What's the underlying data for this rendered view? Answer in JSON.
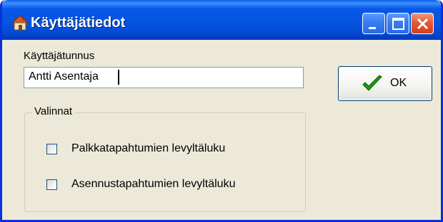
{
  "window": {
    "title": "Käyttäjätiedot",
    "icon": "house-icon"
  },
  "caption_buttons": [
    "minimize",
    "maximize",
    "close"
  ],
  "user_field": {
    "label": "Käyttäjätunnus",
    "value": "Antti Asentaja"
  },
  "ok_button": {
    "label": "OK",
    "icon": "green-checkmark-icon"
  },
  "options_group": {
    "title": "Valinnat",
    "options": [
      {
        "label": "Palkkatapahtumien levyltäluku",
        "checked": false
      },
      {
        "label": "Asennustapahtumien levyltäluku",
        "checked": false
      }
    ]
  },
  "colors": {
    "titlebar": "#0454e0",
    "face": "#ece9d8",
    "close_button": "#e45a35",
    "check_accent": "#1c9a12"
  }
}
